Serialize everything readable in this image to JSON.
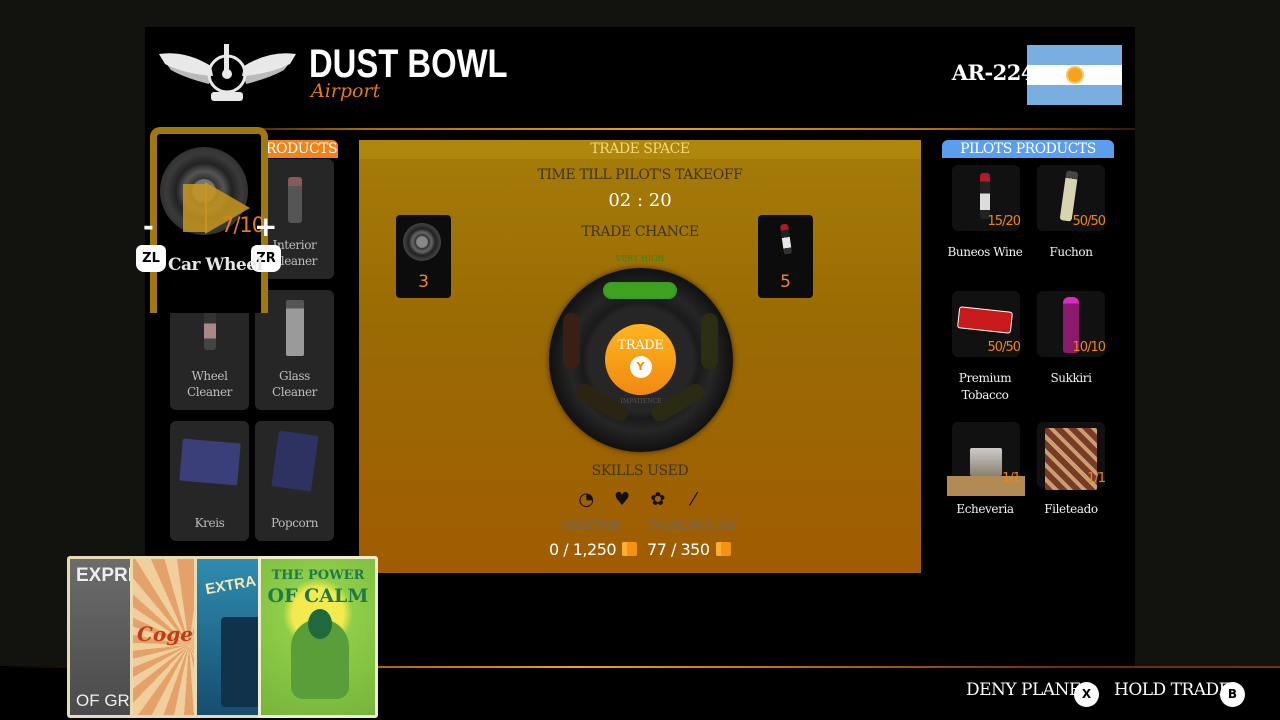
{
  "header": {
    "title": "DUST BOWL",
    "subtitle": "Airport",
    "logo_icon": "winged-propeller-logo",
    "plane_id": "AR-224",
    "flag_icon": "argentina-flag-icon"
  },
  "my_products": {
    "header": "PRODUCTS",
    "selected": {
      "name": "Car Wheel",
      "quantity": "7/10",
      "decrease_label": "-",
      "increase_label": "+",
      "decrease_button": "ZL",
      "increase_button": "ZR"
    },
    "items": [
      {
        "name": "Interior Cleaner"
      },
      {
        "name": "Wheel Cleaner"
      },
      {
        "name": "Glass Cleaner"
      },
      {
        "name": "Kreis"
      },
      {
        "name": "Popcorn"
      }
    ]
  },
  "trade": {
    "header": "TRADE SPACE",
    "timer_label": "TIME TILL PILOT'S TAKEOFF",
    "timer": "02 : 20",
    "chance_label": "TRADE CHANCE",
    "chance_value": "VERY HIGH",
    "offer_left_qty": "3",
    "offer_right_qty": "5",
    "trade_button": "TRADE",
    "trade_button_key": "Y",
    "impatience_label": "IMPATIENCE",
    "skills_label": "SKILLS USED",
    "skills": [
      {
        "icon": "clock-icon",
        "glyph": "◔"
      },
      {
        "icon": "heart-icon",
        "glyph": "♥"
      },
      {
        "icon": "lotus-icon",
        "glyph": "✿"
      },
      {
        "icon": "needle-icon",
        "glyph": "⁄"
      }
    ],
    "airstrip_label": "AIRSTRIP",
    "warehouse_label": "WAREHOUSE",
    "airstrip_value": "0 / 1,250",
    "warehouse_value": "77 / 350"
  },
  "pilot_products": {
    "header": "PILOTS PRODUCTS",
    "items": [
      {
        "name": "Buneos Wine",
        "qty": "15/20"
      },
      {
        "name": "Fuchon",
        "qty": "50/50"
      },
      {
        "name": "Premium Tobacco",
        "qty": "50/50"
      },
      {
        "name": "Sukkiri",
        "qty": "10/10"
      },
      {
        "name": "Echeveria",
        "qty": "1/1"
      },
      {
        "name": "Fileteado",
        "qty": "1/1"
      }
    ]
  },
  "cards": [
    {
      "title": "EXPRES",
      "bottom": "OF GR"
    },
    {
      "title": "Coge"
    },
    {
      "title": "EXTRA T"
    },
    {
      "title": "THE POWER",
      "title2": "OF CALM"
    }
  ],
  "footer": {
    "deny_label": "DENY PLANE",
    "deny_key": "X",
    "hold_label": "HOLD TRADE",
    "hold_key": "B"
  }
}
